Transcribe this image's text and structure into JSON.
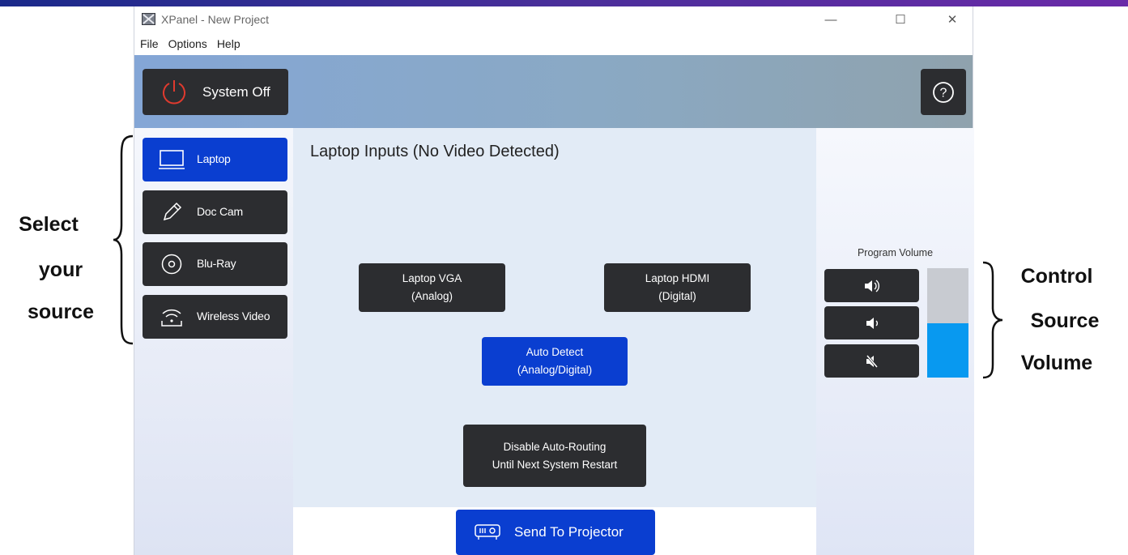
{
  "window": {
    "title": "XPanel - New Project",
    "controls": {
      "minimize": "—",
      "maximize": "☐",
      "close": "✕"
    }
  },
  "menubar": [
    "File",
    "Options",
    "Help"
  ],
  "header": {
    "system_off_label": "System Off",
    "help_label": "?"
  },
  "sources": [
    {
      "label": "Laptop",
      "icon": "laptop-icon",
      "active": true
    },
    {
      "label": "Doc Cam",
      "icon": "pencil-icon",
      "active": false
    },
    {
      "label": "Blu-Ray",
      "icon": "disc-icon",
      "active": false
    },
    {
      "label": "Wireless Video",
      "icon": "wireless-icon",
      "active": false
    }
  ],
  "main": {
    "title": "Laptop Inputs (No Video Detected)",
    "buttons": {
      "vga": [
        "Laptop VGA",
        "(Analog)"
      ],
      "hdmi": [
        "Laptop HDMI",
        "(Digital)"
      ],
      "auto": [
        "Auto Detect",
        "(Analog/Digital)"
      ],
      "disable": [
        "Disable Auto-Routing",
        "Until Next System Restart"
      ]
    },
    "send_label": "Send To Projector"
  },
  "volume": {
    "label": "Program Volume",
    "level_fraction": 0.5,
    "buttons": [
      "volume-up-icon",
      "volume-down-icon",
      "mute-icon"
    ]
  },
  "annotations": {
    "left": [
      "Select",
      "your",
      "source"
    ],
    "right": [
      "Control",
      "Source",
      "Volume"
    ]
  },
  "colors": {
    "accent": "#0a3ed0",
    "button": "#2c2d30",
    "volume_fill": "#0899f0"
  }
}
